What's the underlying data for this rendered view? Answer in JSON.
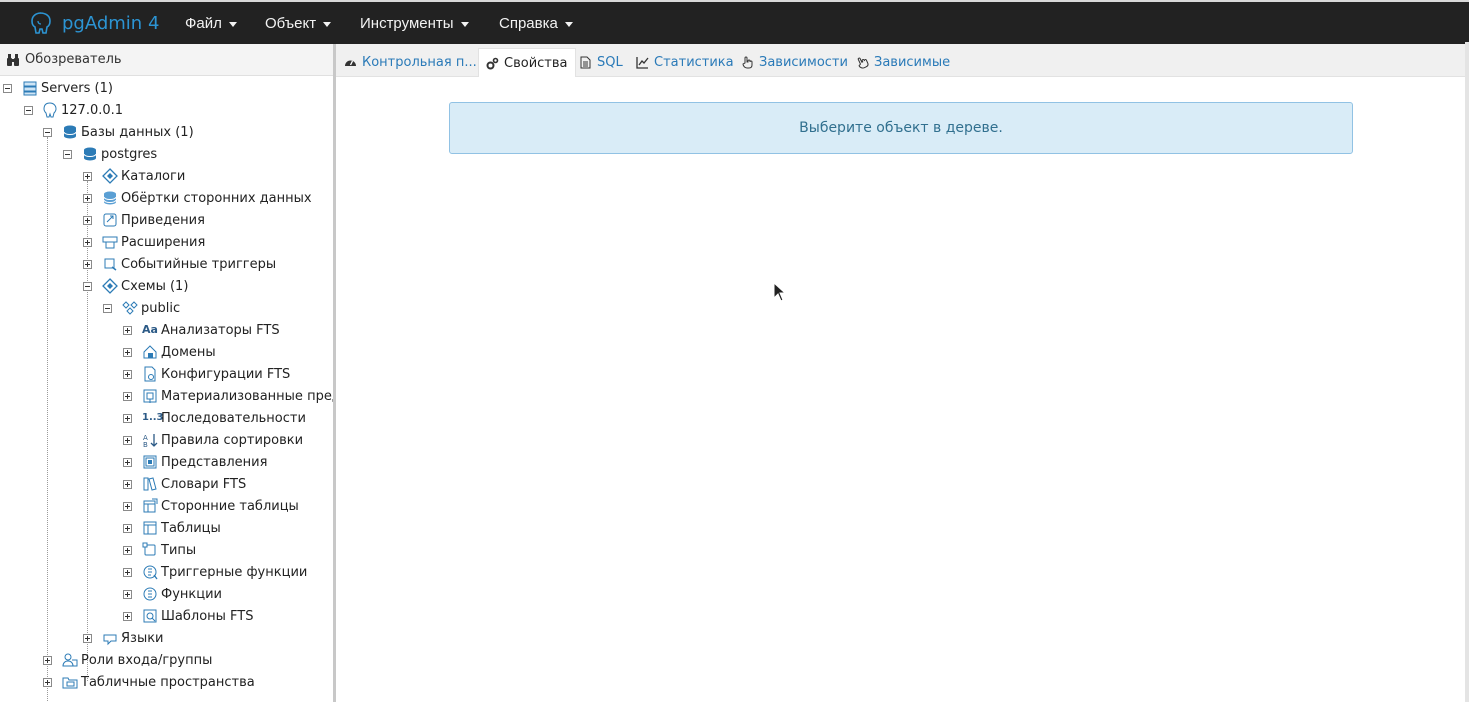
{
  "app": {
    "title": "pgAdmin 4",
    "menu": [
      {
        "label": "Файл"
      },
      {
        "label": "Объект"
      },
      {
        "label": "Инструменты"
      },
      {
        "label": "Справка"
      }
    ]
  },
  "browser": {
    "title": "Обозреватель",
    "tree": {
      "servers": "Servers (1)",
      "server": "127.0.0.1",
      "databases": "Базы данных (1)",
      "db": "postgres",
      "catalogs": "Каталоги",
      "fdw": "Обёртки сторонних данных",
      "casts": "Приведения",
      "extensions": "Расширения",
      "event_triggers": "Событийные триггеры",
      "schemas": "Схемы (1)",
      "schema": "public",
      "schema_children": [
        "Анализаторы FTS",
        "Домены",
        "Конфигурации FTS",
        "Материализованные представления",
        "Последовательности",
        "Правила сортировки",
        "Представления",
        "Словари FTS",
        "Сторонние таблицы",
        "Таблицы",
        "Типы",
        "Триггерные функции",
        "Функции",
        "Шаблоны FTS"
      ],
      "languages": "Языки",
      "roles": "Роли входа/группы",
      "tablespaces": "Табличные пространства"
    }
  },
  "tabs": [
    {
      "label": "Контрольная п...",
      "icon": "dashboard-icon"
    },
    {
      "label": "Свойства",
      "icon": "cogs-icon"
    },
    {
      "label": "SQL",
      "icon": "file-text-icon"
    },
    {
      "label": "Статистика",
      "icon": "line-chart-icon"
    },
    {
      "label": "Зависимости",
      "icon": "hand-pointer-icon"
    },
    {
      "label": "Зависимые",
      "icon": "hand-pointer-icon"
    }
  ],
  "main": {
    "message": "Выберите объект в дереве."
  },
  "colors": {
    "navbar": "#222222",
    "brand": "#2c94d3",
    "link": "#2a7ab8",
    "alert_bg": "#d9ecf7",
    "alert_text": "#31708f"
  }
}
